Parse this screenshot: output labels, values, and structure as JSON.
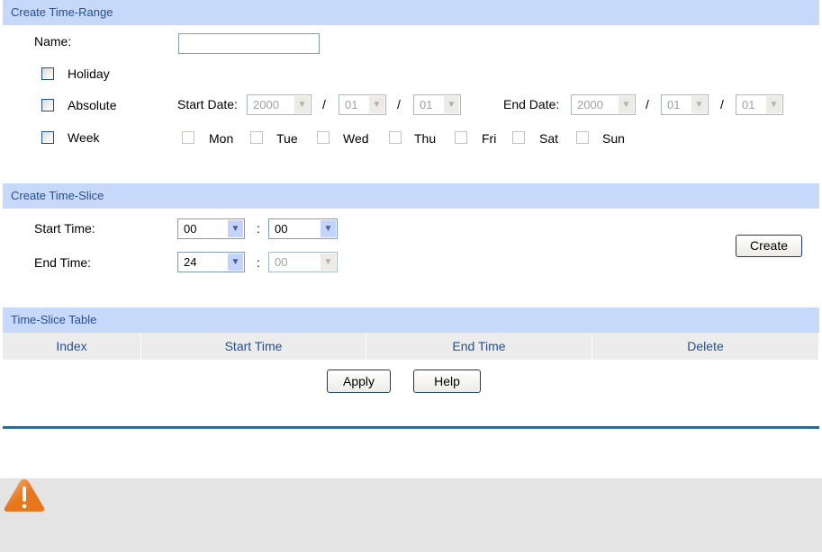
{
  "range": {
    "title": "Create Time-Range",
    "name_label": "Name:",
    "name_value": "",
    "holiday": "Holiday",
    "absolute": "Absolute",
    "week": "Week",
    "start_date_label": "Start Date:",
    "end_date_label": "End Date:",
    "sep": "/",
    "start_year": "2000",
    "start_month": "01",
    "start_day": "01",
    "end_year": "2000",
    "end_month": "01",
    "end_day": "01",
    "days": [
      "Mon",
      "Tue",
      "Wed",
      "Thu",
      "Fri",
      "Sat",
      "Sun"
    ]
  },
  "slice": {
    "title": "Create Time-Slice",
    "start_label": "Start Time:",
    "end_label": "End Time:",
    "colon": ":",
    "start_hour": "00",
    "start_min": "00",
    "end_hour": "24",
    "end_min": "00",
    "create": "Create"
  },
  "table": {
    "title": "Time-Slice Table",
    "columns": [
      "Index",
      "Start Time",
      "End Time",
      "Delete"
    ]
  },
  "buttons": {
    "apply": "Apply",
    "help": "Help"
  },
  "colors": {
    "header_bg": "#c6d9fb",
    "header_text": "#254f8f",
    "divider": "#2e6a8e",
    "warning": "#e8761d"
  }
}
